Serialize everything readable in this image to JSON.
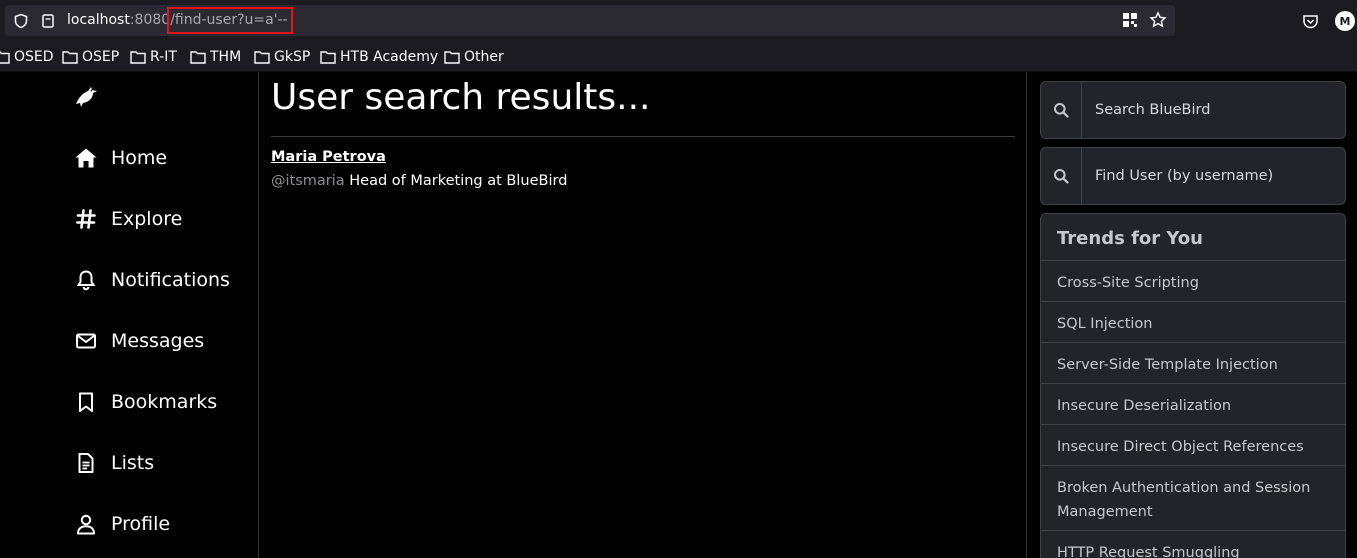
{
  "browser": {
    "url_host": "localhost",
    "url_port": ":8080",
    "url_path": "/find-user?u=a'--",
    "bookmarks": [
      "OSED",
      "OSEP",
      "R-IT",
      "THM",
      "GkSP",
      "HTB Academy",
      "Other"
    ],
    "profile_initial": "M"
  },
  "nav": {
    "items": [
      "Home",
      "Explore",
      "Notifications",
      "Messages",
      "Bookmarks",
      "Lists",
      "Profile"
    ]
  },
  "main": {
    "title": "User search results...",
    "result": {
      "name": "Maria Petrova",
      "handle": "@itsmaria",
      "bio": "Head of Marketing at BlueBird"
    }
  },
  "sidebar": {
    "search_placeholder": "Search BlueBird",
    "find_user_placeholder": "Find User (by username)",
    "trends_title": "Trends for You",
    "trends": [
      "Cross-Site Scripting",
      "SQL Injection",
      "Server-Side Template Injection",
      "Insecure Deserialization",
      "Insecure Direct Object References",
      "Broken Authentication and Session Management",
      "HTTP Request Smuggling"
    ]
  },
  "colors": {
    "highlight": "#e3121b",
    "panel": "#212529",
    "background": "#000000"
  }
}
